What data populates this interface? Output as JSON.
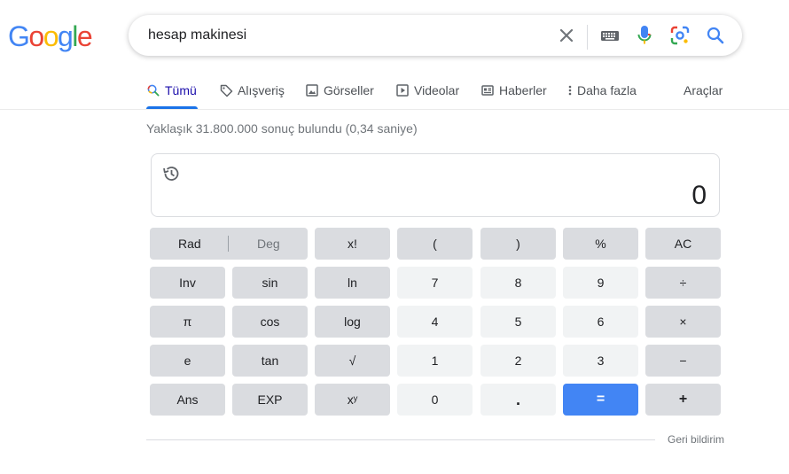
{
  "logo": {
    "letters": [
      "G",
      "o",
      "o",
      "g",
      "l",
      "e"
    ],
    "colors": [
      "#4285f4",
      "#ea4335",
      "#fbbc05",
      "#4285f4",
      "#34a853",
      "#ea4335"
    ]
  },
  "search": {
    "query": "hesap makinesi",
    "icons": [
      "close-icon",
      "keyboard-icon",
      "mic-icon",
      "lens-icon",
      "search-icon"
    ]
  },
  "tabs": [
    {
      "label": "Tümü",
      "icon": "search-icon",
      "active": true
    },
    {
      "label": "Alışveriş",
      "icon": "tag-icon"
    },
    {
      "label": "Görseller",
      "icon": "image-icon"
    },
    {
      "label": "Videolar",
      "icon": "play-icon"
    },
    {
      "label": "Haberler",
      "icon": "news-icon"
    },
    {
      "label": "Daha fazla",
      "icon": "more-vert-icon"
    }
  ],
  "tools_label": "Araçlar",
  "result_stats": "Yaklaşık 31.800.000 sonuç bulundu (0,34 saniye)",
  "calculator": {
    "display": "0",
    "history_icon": "history-icon",
    "mode": {
      "rad": "Rad",
      "deg": "Deg"
    },
    "keys": {
      "fact": "x!",
      "lparen": "(",
      "rparen": ")",
      "percent": "%",
      "ac": "AC",
      "inv": "Inv",
      "sin": "sin",
      "ln": "ln",
      "d7": "7",
      "d8": "8",
      "d9": "9",
      "div": "÷",
      "pi": "π",
      "cos": "cos",
      "log": "log",
      "d4": "4",
      "d5": "5",
      "d6": "6",
      "mul": "×",
      "e": "e",
      "tan": "tan",
      "sqrt": "√",
      "d1": "1",
      "d2": "2",
      "d3": "3",
      "sub": "−",
      "ans": "Ans",
      "exp": "EXP",
      "pow": "xʸ",
      "d0": "0",
      "dot": ".",
      "eq": "=",
      "add": "+"
    }
  },
  "feedback_label": "Geri bildirim"
}
